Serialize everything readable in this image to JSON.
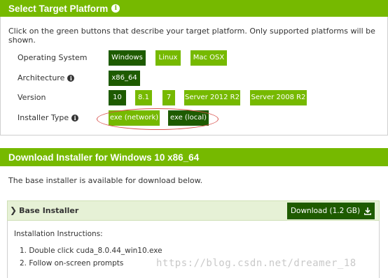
{
  "select_platform": {
    "title": "Select Target Platform",
    "description": "Click on the green buttons that describe your target platform. Only supported platforms will be shown.",
    "rows": {
      "os": {
        "label": "Operating System",
        "options": [
          "Windows",
          "Linux",
          "Mac OSX"
        ],
        "selected": "Windows"
      },
      "arch": {
        "label": "Architecture",
        "options": [
          "x86_64"
        ],
        "selected": "x86_64"
      },
      "version": {
        "label": "Version",
        "options": [
          "10",
          "8.1",
          "7",
          "Server 2012 R2",
          "Server 2008 R2"
        ],
        "selected": "10"
      },
      "installer": {
        "label": "Installer Type",
        "options": [
          "exe (network)",
          "exe (local)"
        ],
        "selected": "exe (local)"
      }
    }
  },
  "download": {
    "title": "Download Installer for Windows 10 x86_64",
    "description": "The base installer is available for download below.",
    "base_installer_label": "Base Installer",
    "download_button": "Download (1.2 GB)",
    "instructions_title": "Installation Instructions:",
    "steps": [
      "1. Double click cuda_8.0.44_win10.exe",
      "2. Follow on-screen prompts"
    ]
  },
  "watermark": "https://blog.csdn.net/dreamer_18",
  "colors": {
    "accent": "#76b900",
    "selected": "#1e5b00",
    "annotation": "#d9534f"
  },
  "icons": {
    "info": "info-icon",
    "chevron": "chevron-right-icon",
    "download": "download-icon"
  }
}
